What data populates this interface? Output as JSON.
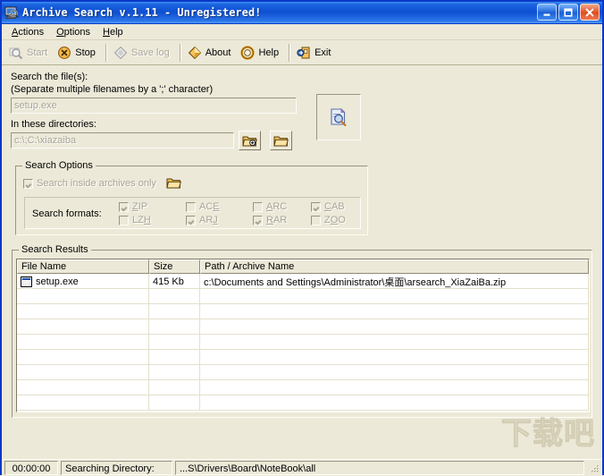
{
  "window": {
    "title": "Archive Search v.1.11 - Unregistered!",
    "icon": "app-search-computer-icon",
    "buttons": {
      "minimize": "minimize-button",
      "maximize": "maximize-button",
      "close": "close-button"
    }
  },
  "menu": {
    "items": [
      {
        "label": "Actions",
        "accel": "A"
      },
      {
        "label": "Options",
        "accel": "O"
      },
      {
        "label": "Help",
        "accel": "H"
      }
    ]
  },
  "toolbar": {
    "buttons": [
      {
        "label": "Start",
        "icon": "magnifier-icon",
        "enabled": false
      },
      {
        "label": "Stop",
        "icon": "stop-circle-icon",
        "enabled": true
      },
      {
        "label": "Save log",
        "icon": "diamond-save-icon",
        "enabled": false
      },
      {
        "label": "About",
        "icon": "diamond-about-icon",
        "enabled": true
      },
      {
        "label": "Help",
        "icon": "lifebuoy-icon",
        "enabled": true
      },
      {
        "label": "Exit",
        "icon": "exit-door-icon",
        "enabled": true
      }
    ]
  },
  "search": {
    "files_label": "Search the file(s):",
    "files_hint": "(Separate multiple filenames by a ';' character)",
    "files_value": "setup.exe",
    "dirs_label": "In these directories:",
    "dirs_value": "c:\\;C:\\xiazaiba",
    "add_dir_icon": "add-folder-icon",
    "browse_dir_icon": "open-folder-icon",
    "preview_icon": "document-search-icon"
  },
  "options": {
    "group_title": "Search Options",
    "inside_archives": {
      "label": "Search inside archives only",
      "checked": true,
      "enabled": false,
      "icon": "folder-icon"
    },
    "formats_label": "Search formats:",
    "formats": [
      {
        "label": "ZIP",
        "accel": "Z",
        "checked": true
      },
      {
        "label": "ACE",
        "accel": "E",
        "checked": false
      },
      {
        "label": "ARC",
        "accel": "A",
        "checked": false
      },
      {
        "label": "CAB",
        "accel": "C",
        "checked": true
      },
      {
        "label": "LZH",
        "accel": "H",
        "checked": false
      },
      {
        "label": "ARJ",
        "accel": "J",
        "checked": true
      },
      {
        "label": "RAR",
        "accel": "R",
        "checked": true
      },
      {
        "label": "ZOO",
        "accel": "O",
        "checked": false
      }
    ]
  },
  "results": {
    "group_title": "Search Results",
    "columns": [
      "File Name",
      "Size",
      "Path / Archive Name"
    ],
    "rows": [
      {
        "icon": "file-icon",
        "name": "setup.exe",
        "size": "415 Kb",
        "path": "c:\\Documents and Settings\\Administrator\\桌面\\arsearch_XiaZaiBa.zip"
      }
    ],
    "empty_row_count": 8
  },
  "statusbar": {
    "elapsed": "00:00:00",
    "state_label": "Searching Directory:",
    "current_path": "...S\\Drivers\\Board\\NoteBook\\all"
  },
  "watermark": {
    "text": "下载吧",
    "url": "www.xiazaiba.com"
  },
  "colors": {
    "face": "#ece9d8",
    "title_blue": "#0e4fd2",
    "close_red": "#e04a20",
    "accent_orange": "#f0a830"
  }
}
